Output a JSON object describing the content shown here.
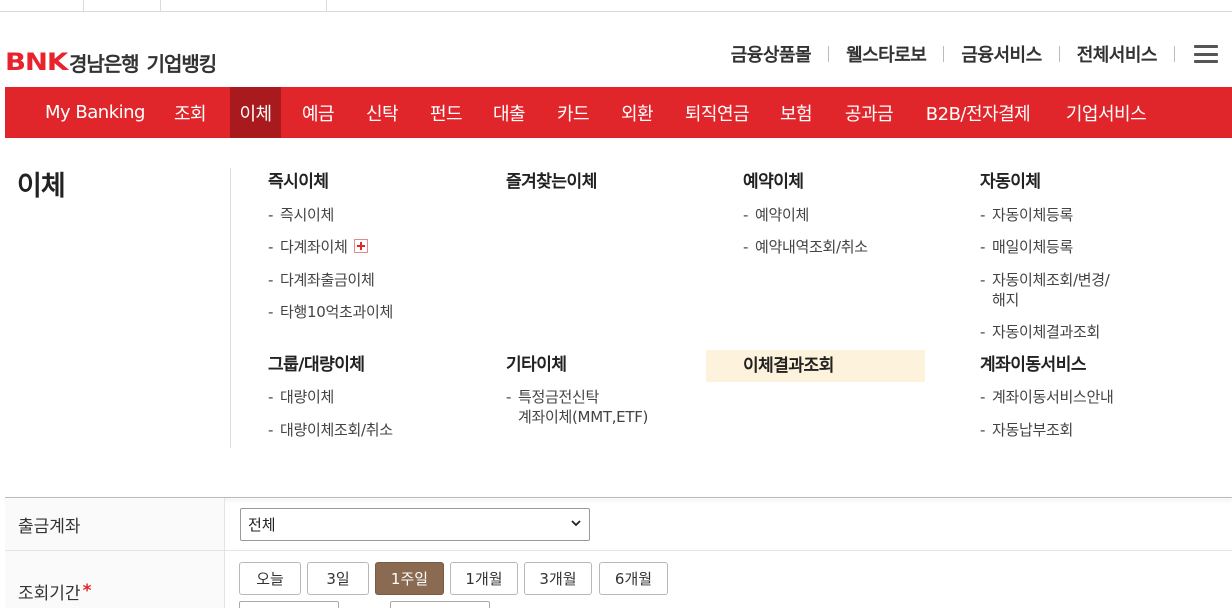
{
  "header": {
    "logo_mark": "BNK",
    "logo_bank": "경남은행",
    "logo_service": "기업뱅킹"
  },
  "util_nav": [
    "금융상품몰",
    "웰스타로보",
    "금융서비스",
    "전체서비스"
  ],
  "gnb": [
    {
      "label": "My Banking"
    },
    {
      "label": "조회"
    },
    {
      "label": "이체",
      "active": true
    },
    {
      "label": "예금"
    },
    {
      "label": "신탁"
    },
    {
      "label": "펀드"
    },
    {
      "label": "대출"
    },
    {
      "label": "카드"
    },
    {
      "label": "외환"
    },
    {
      "label": "퇴직연금"
    },
    {
      "label": "보험"
    },
    {
      "label": "공과금"
    },
    {
      "label": "B2B/전자결제"
    },
    {
      "label": "기업서비스"
    }
  ],
  "mega_menu": {
    "title": "이체",
    "groups": [
      {
        "title": "즉시이체",
        "items": [
          "즉시이체",
          "다계좌이체",
          "다계좌출금이체",
          "타행10억초과이체"
        ]
      },
      {
        "title": "즐겨찾는이체",
        "items": []
      },
      {
        "title": "예약이체",
        "items": [
          "예약이체",
          "예약내역조회/취소"
        ]
      },
      {
        "title": "자동이체",
        "items": [
          "자동이체등록",
          "매일이체등록",
          "자동이체조회/변경/",
          "해지",
          "자동이체결과조회"
        ]
      },
      {
        "title": "그룹/대량이체",
        "items": [
          "대량이체",
          "대량이체조회/취소"
        ]
      },
      {
        "title": "기타이체",
        "items": [
          "특정금전신탁",
          "계좌이체(MMT,ETF)"
        ]
      },
      {
        "title": "이체결과조회",
        "items": [],
        "highlight": true
      },
      {
        "title": "계좌이동서비스",
        "items": [
          "계좌이동서비스안내",
          "자동납부조회"
        ]
      }
    ]
  },
  "form": {
    "account_label": "출금계좌",
    "account_value": "전체",
    "period_label": "조회기간",
    "period_required": "*",
    "period_buttons": [
      "오늘",
      "3일",
      "1주일",
      "1개월",
      "3개월",
      "6개월"
    ],
    "period_selected": "1주일"
  },
  "colors": {
    "brand_red": "#e1262b",
    "active_menu": "#a81a1d",
    "selected_button": "#8a6a50",
    "highlight_bg": "#fdf3dc"
  }
}
